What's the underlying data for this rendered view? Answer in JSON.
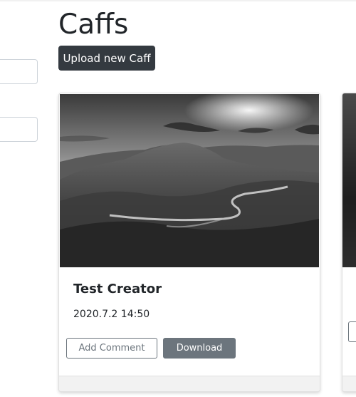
{
  "header": {
    "title": "Caffs",
    "upload_label": "Upload new Caff"
  },
  "sidebar": {
    "filters": [
      {
        "value": "",
        "placeholder": ""
      },
      {
        "value": "",
        "placeholder": ""
      }
    ]
  },
  "cards": [
    {
      "creator": "Test Creator",
      "date": "2020.7.2 14:50",
      "image_icon": "landscape-preview",
      "add_comment_label": "Add Comment",
      "download_label": "Download"
    }
  ],
  "colors": {
    "dark_button": "#343a40",
    "secondary": "#6c757d",
    "text": "#212529",
    "footer": "#f2f2f2"
  }
}
